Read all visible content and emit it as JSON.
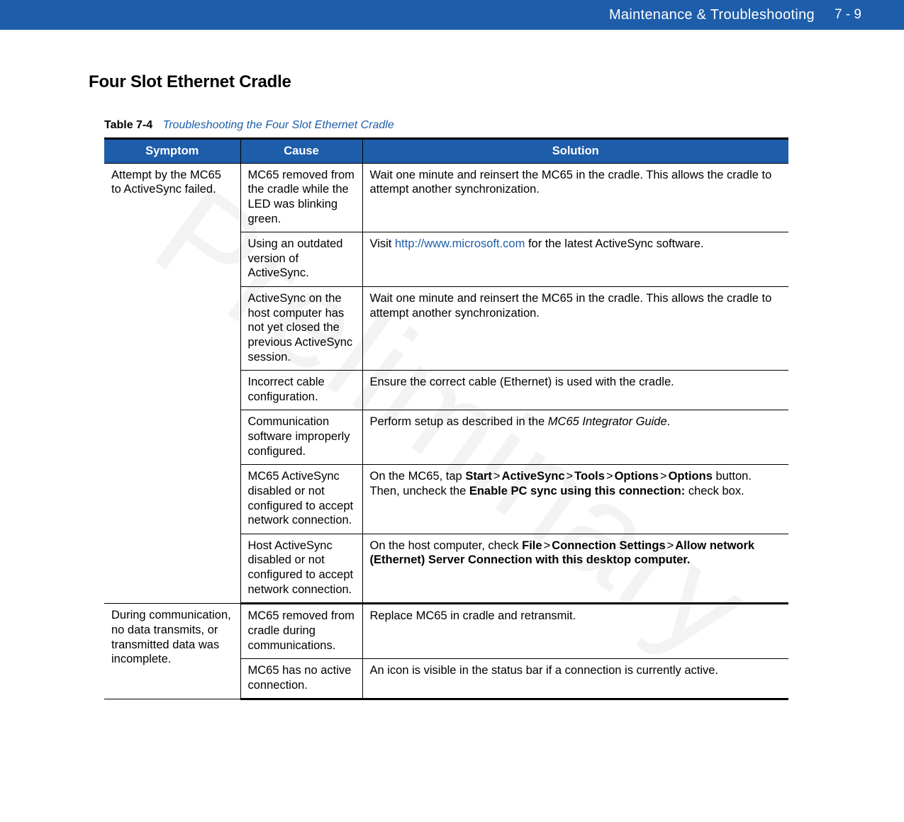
{
  "header": {
    "section": "Maintenance & Troubleshooting",
    "page": "7 - 9"
  },
  "watermark": "Preliminary",
  "section_title": "Four Slot Ethernet Cradle",
  "table": {
    "label": "Table 7-4",
    "title": "Troubleshooting the Four Slot Ethernet Cradle",
    "columns": [
      "Symptom",
      "Cause",
      "Solution"
    ]
  },
  "rows": {
    "r1_symptom": "Attempt by the MC65 to ActiveSync failed.",
    "r1a_cause": "MC65 removed from the cradle while the LED was blinking green.",
    "r1a_solution": "Wait one minute and reinsert the MC65 in the cradle. This allows the cradle to attempt another synchronization.",
    "r1b_cause": "Using an outdated version of ActiveSync.",
    "r1b_solution_pre": "Visit ",
    "r1b_solution_link": "http://www.microsoft.com",
    "r1b_solution_post": " for the latest ActiveSync software.",
    "r1c_cause": "ActiveSync on the host computer has not yet closed the previous ActiveSync session.",
    "r1c_solution": "Wait one minute and reinsert the MC65 in the cradle. This allows the cradle to attempt another synchronization.",
    "r1d_cause": "Incorrect cable configuration.",
    "r1d_solution": "Ensure the correct cable (Ethernet) is used with the cradle.",
    "r1e_cause": "Communication software improperly configured.",
    "r1e_solution_pre": "Perform setup as described in the ",
    "r1e_solution_italic": "MC65 Integrator Guide",
    "r1e_solution_post": ".",
    "r1f_cause": "MC65 ActiveSync disabled or not configured to accept network connection.",
    "r1f_pre": "On the MC65, tap ",
    "r1f_b1": "Start",
    "r1f_b2": "ActiveSync",
    "r1f_b3": "Tools",
    "r1f_b4": "Options",
    "r1f_b5": "Options",
    "r1f_mid": " button. Then, uncheck the ",
    "r1f_b6": "Enable PC sync using this connection:",
    "r1f_post": " check box.",
    "r1g_cause": "Host ActiveSync disabled or not configured to accept network connection.",
    "r1g_pre": "On the host computer, check ",
    "r1g_b1": "File",
    "r1g_b2": "Connection Settings",
    "r1g_b3": "Allow network (Ethernet) Server Connection with this desktop computer.",
    "gt": ">",
    "r2_symptom": "During communication, no data transmits, or transmitted data was incomplete.",
    "r2a_cause": "MC65 removed from cradle during communications.",
    "r2a_solution": "Replace MC65 in cradle and retransmit.",
    "r2b_cause": "MC65 has no active connection.",
    "r2b_solution": "An icon is visible in the status bar if a connection is currently active."
  }
}
